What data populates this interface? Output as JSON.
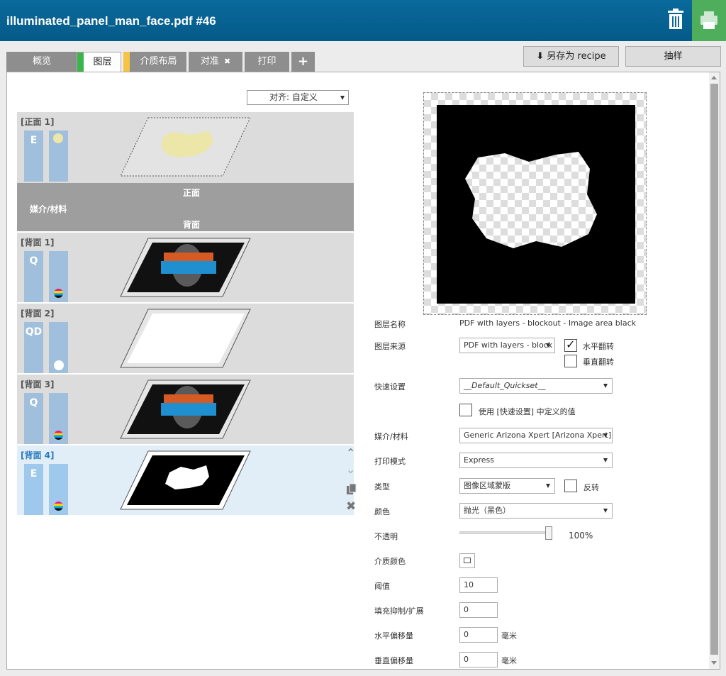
{
  "header": {
    "title": "illuminated_panel_man_face.pdf #46"
  },
  "tabs": [
    {
      "label": "概览",
      "color": ""
    },
    {
      "label": "图层",
      "color": "#3bb54a"
    },
    {
      "label": "介质布局",
      "color": "#f5c445"
    },
    {
      "label": "对准",
      "close": "✖"
    },
    {
      "label": "打印"
    },
    {
      "label": "+"
    }
  ],
  "top_buttons": {
    "save_recipe": "另存为 recipe",
    "save_icon": "⬇",
    "sample": "抽样"
  },
  "align_select": {
    "value": "对齐: 自定义"
  },
  "layers": [
    {
      "name": "[正面 1]",
      "col1": "E",
      "indicator": "yellow-dot"
    },
    {
      "name": "[背面 1]",
      "col1": "Q",
      "indicator": "cmyk"
    },
    {
      "name": "[背面 2]",
      "col1": "QD",
      "indicator": "white-dot"
    },
    {
      "name": "[背面 3]",
      "col1": "Q",
      "indicator": "cmyk"
    },
    {
      "name": "[背面 4]",
      "col1": "E",
      "indicator": "cmyk"
    }
  ],
  "media": {
    "front": "正面",
    "label": "媒介/材料",
    "back": "背面"
  },
  "props": {
    "layer_name_label": "图层名称",
    "layer_name_value": "PDF with layers - blockout - Image area black",
    "layer_source_label": "图层来源",
    "layer_source_value": "PDF with layers - block",
    "flip_h_label": "水平翻转",
    "flip_v_label": "垂直翻转",
    "quickset_label": "快速设置",
    "quickset_value": "__Default_Quickset__",
    "use_quickset_label": "使用 [快速设置] 中定义的值",
    "media_label": "媒介/材料",
    "media_value": "Generic Arizona Xpert [Arizona Xpert]",
    "print_mode_label": "打印模式",
    "print_mode_value": "Express",
    "type_label": "类型",
    "type_value": "图像区域蒙版",
    "invert_label": "反转",
    "color_label": "颜色",
    "color_value": "抛光（黑色）",
    "opacity_label": "不透明",
    "opacity_value": "100%",
    "opacity_level": 1.0,
    "media_color_label": "介质颜色",
    "threshold_label": "阈值",
    "threshold_value": "10",
    "choke_label": "填充抑制/扩展",
    "choke_value": "0",
    "h_offset_label": "水平偏移量",
    "h_offset_value": "0",
    "v_offset_label": "垂直偏移量",
    "v_offset_value": "0",
    "unit": "毫米"
  }
}
